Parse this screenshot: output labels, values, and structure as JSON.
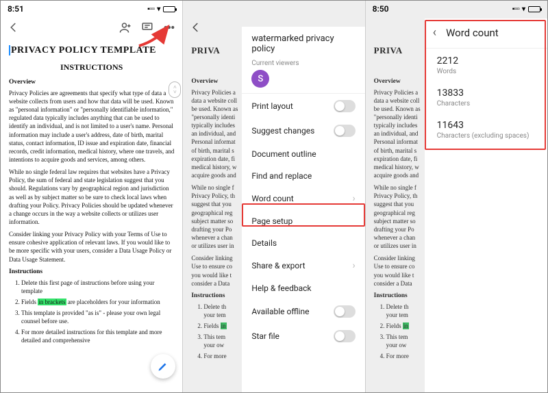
{
  "status": {
    "time1": "8:51",
    "time2": "8:50",
    "signal": "▮▯▯▯",
    "wifi": "●",
    "battery_pct": 85
  },
  "toolbar": {
    "back": "‹",
    "addperson": "add-person",
    "comment": "comment",
    "more": "more"
  },
  "document": {
    "title": "PRIVACY POLICY TEMPLATE",
    "h2": "INSTRUCTIONS",
    "overview_h": "Overview",
    "p1": "Privacy Policies are agreements that specify what type of data a website collects from users and how that data will be used. Known as \"personal information\" or \"personally identifiable information,\" regulated data typically includes anything that can be used to identify an individual, and is not limited to a user's name. Personal information may include a user's address, date of birth, marital status, contact information, ID issue and expiration date, financial records, credit information, medical history, where one travels, and intentions to acquire goods and services, among others.",
    "p2": "While no single federal law requires that websites have a Privacy Policy, the sum of federal and state legislation suggest that you should. Regulations vary by geographical region and jurisdiction as well as by subject matter so be sure to check local laws when drafting your Policy. Privacy Policies should be updated whenever a change occurs in the way a website collects or utilizes user information.",
    "p3": "Consider linking your Privacy Policy with your Terms of Use to ensure cohesive application of relevant laws. If you would like to be more specific with your users, consider a Data Usage Policy or Data Usage Statement.",
    "instructions_h": "Instructions",
    "li1a": "Delete this first page of instructions before using your template",
    "li2a": "Fields ",
    "li2b": "in brackets",
    "li2c": " are placeholders for your information",
    "li3a": "This template is provided \"as is\" - please your own legal counsel before use.",
    "li4a": "For more detailed instructions for this template and more detailed and comprehensive"
  },
  "doc_partial": {
    "p1": "Privacy Policies a\ndata a website coll\nbe used. Known as\n\"personally identi\ntypically includes\nan individual, and\nPersonal informat\nof birth, marital s\nexpiration date, fi\nmedical history, w\nacquire goods and",
    "p2": "While no single f\nPrivacy Policy, th\nsuggest that you\ngeographical reg\nsubject matter so\ndrafting your Po\nwhenever a chan\nor utilizes user in",
    "p3": "Consider linking\nUse to ensure co\nyou would like t\nconsider a Data",
    "li1": "Delete th\nyour tem",
    "li2": "Fields ",
    "li3": "This tem\nyour ow",
    "li4": "For more"
  },
  "sheet": {
    "doc_title": "watermarked privacy policy",
    "current_viewers": "Current viewers",
    "avatar_initial": "S",
    "items": {
      "print_layout": "Print layout",
      "suggest_changes": "Suggest changes",
      "doc_outline": "Document outline",
      "find_replace": "Find and replace",
      "word_count": "Word count",
      "page_setup": "Page setup",
      "details": "Details",
      "share_export": "Share & export",
      "help_feedback": "Help & feedback",
      "available_offline": "Available offline",
      "star_file": "Star file"
    }
  },
  "wordcount": {
    "title": "Word count",
    "words_n": "2212",
    "words_l": "Words",
    "chars_n": "13833",
    "chars_l": "Characters",
    "charsx_n": "11643",
    "charsx_l": "Characters (excluding spaces)"
  }
}
